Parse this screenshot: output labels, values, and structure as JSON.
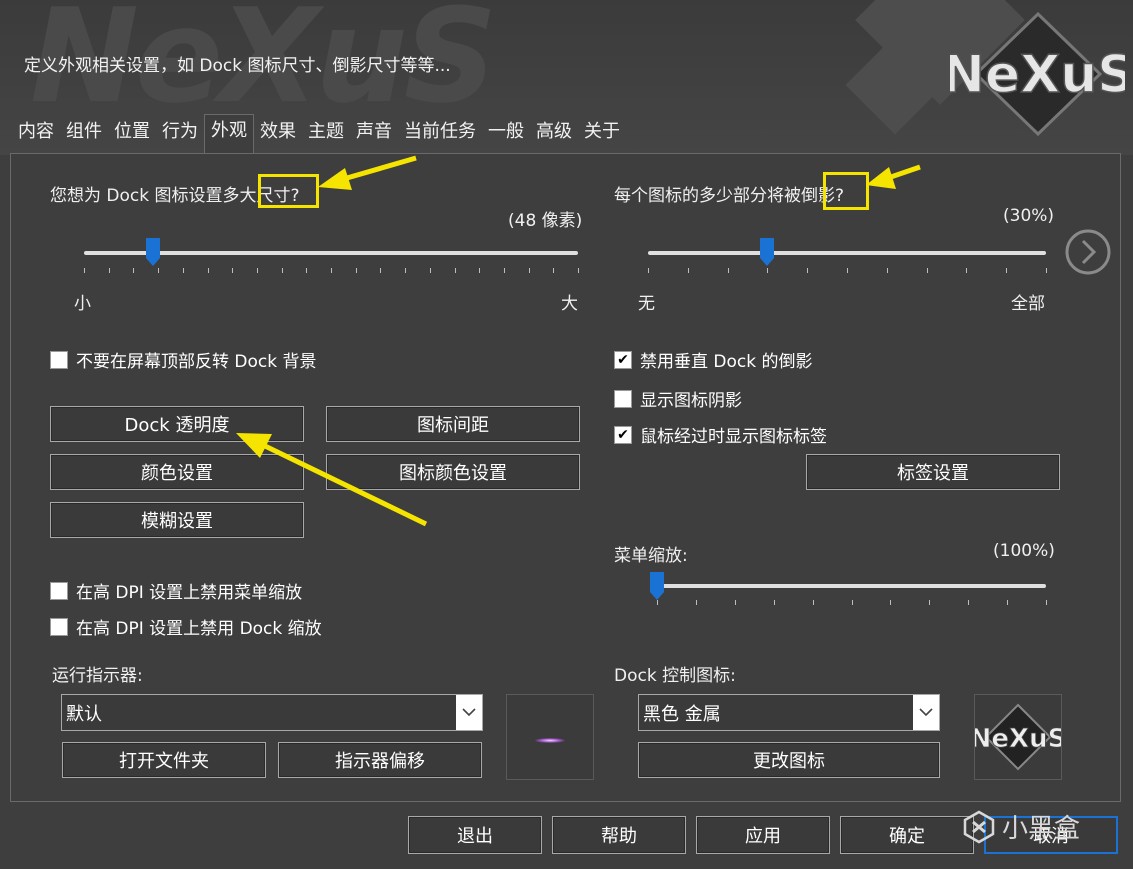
{
  "header": {
    "subtitle": "定义外观相关设置，如 Dock 图标尺寸、倒影尺寸等等...",
    "logo_text": "NeXuS"
  },
  "tabs": [
    "内容",
    "组件",
    "位置",
    "行为",
    "外观",
    "效果",
    "主题",
    "声音",
    "当前任务",
    "一般",
    "高级",
    "关于"
  ],
  "active_tab": "外观",
  "icon_size": {
    "question": "您想为 Dock 图标设置多大尺寸?",
    "value_text": "(48 像素)",
    "min_label": "小",
    "max_label": "大",
    "level_percent": 14
  },
  "reflection": {
    "question": "每个图标的多少部分将被倒影?",
    "value_text": "(30%)",
    "min_label": "无",
    "max_label": "全部",
    "level_percent": 30
  },
  "checkboxes": {
    "invert_bg": {
      "label": "不要在屏幕顶部反转 Dock 背景",
      "checked": false
    },
    "disable_vertical_reflection": {
      "label": "禁用垂直 Dock 的倒影",
      "checked": true
    },
    "show_icon_shadow": {
      "label": "显示图标阴影",
      "checked": false
    },
    "show_labels_on_hover": {
      "label": "鼠标经过时显示图标标签",
      "checked": true
    },
    "disable_menu_scaling": {
      "label": "在高 DPI 设置上禁用菜单缩放",
      "checked": false
    },
    "disable_dock_scaling": {
      "label": "在高 DPI 设置上禁用 Dock 缩放",
      "checked": false
    }
  },
  "buttons": {
    "dock_transparency": "Dock 透明度",
    "icon_spacing": "图标间距",
    "color_settings": "颜色设置",
    "icon_color_settings": "图标颜色设置",
    "blur_settings": "模糊设置",
    "label_settings": "标签设置",
    "open_folder": "打开文件夹",
    "indicator_offset": "指示器偏移",
    "change_icon": "更改图标"
  },
  "menu_scale": {
    "label": "菜单缩放:",
    "value_text": "(100%)",
    "level_percent": 0
  },
  "run_indicator": {
    "label": "运行指示器:",
    "selected": "默认"
  },
  "dock_control_icon": {
    "label": "Dock 控制图标:",
    "selected": "黑色 金属"
  },
  "footer": {
    "exit": "退出",
    "help": "帮助",
    "apply": "应用",
    "ok": "确定",
    "cancel": "取消"
  },
  "watermark": "小黑盒",
  "colors": {
    "background": "#3e3e3e",
    "accent": "#1a73d4",
    "highlight": "#f4e400"
  }
}
